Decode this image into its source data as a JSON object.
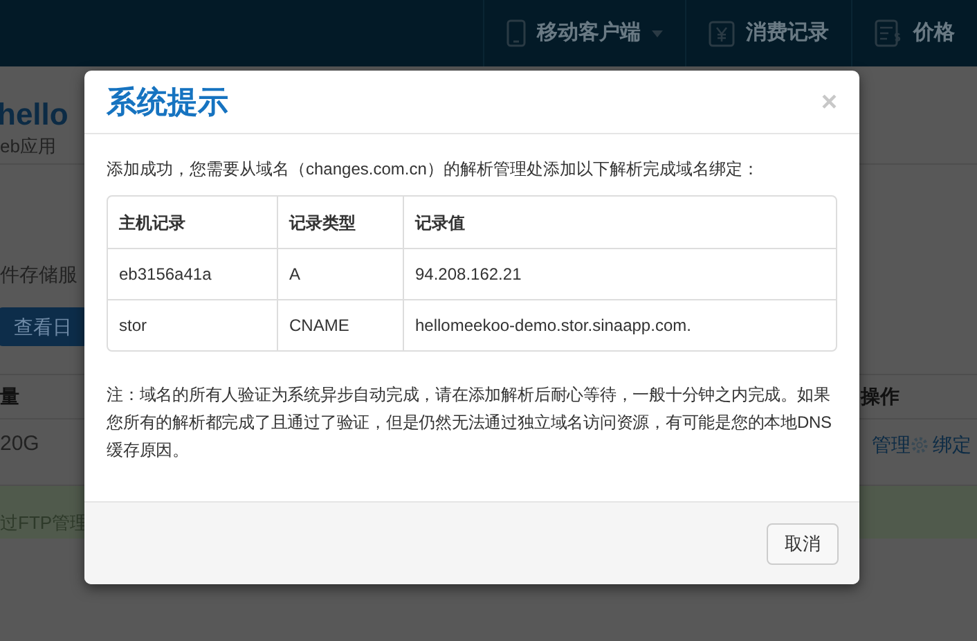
{
  "navbar": {
    "items": [
      {
        "label": "移动客户端",
        "kind": "dropdown"
      },
      {
        "label": "消费记录",
        "kind": "receipt"
      },
      {
        "label": "价格",
        "kind": "price"
      }
    ]
  },
  "page": {
    "app_name": "hello",
    "app_type": "eb应用",
    "storage_text": "件存储服",
    "log_button": "查看日",
    "table": {
      "header": {
        "column_1": "量",
        "actions": "操作"
      },
      "row": {
        "column_1": "20G",
        "actions": [
          "管理",
          "绑定"
        ]
      }
    },
    "notice": "过FTP管理"
  },
  "dialog": {
    "title": "系统提示",
    "close": "×",
    "intro": "添加成功，您需要从域名（changes.com.cn）的解析管理处添加以下解析完成域名绑定：",
    "table": {
      "columns": [
        "主机记录",
        "记录类型",
        "记录值"
      ],
      "rows": [
        [
          "eb3156a41a",
          "A",
          "94.208.162.21"
        ],
        [
          "stor",
          "CNAME",
          "hellomeekoo-demo.stor.sinaapp.com."
        ]
      ]
    },
    "note": "注：域名的所有人验证为系统异步自动完成，请在添加解析后耐心等待，一般十分钟之内完成。如果您所有的解析都完成了且通过了验证，但是仍然无法通过独立域名访问资源，有可能是您的本地DNS缓存原因。",
    "buttons": [
      "取消"
    ]
  }
}
